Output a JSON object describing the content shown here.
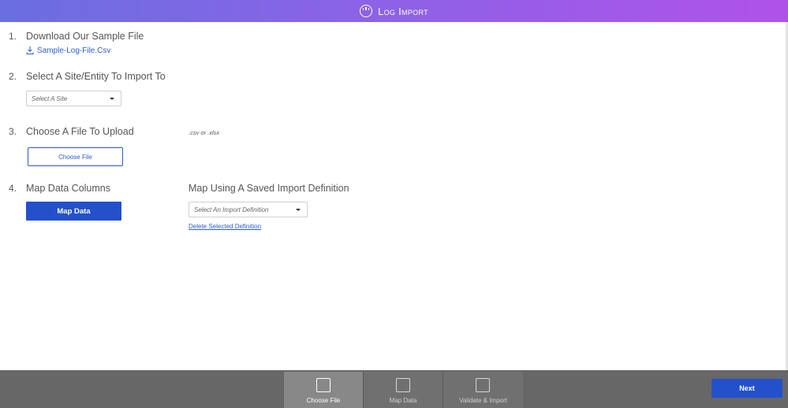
{
  "header": {
    "title": "Log Import",
    "logo_icon": "timer-logo-icon"
  },
  "steps": [
    {
      "number": "1.",
      "title": "Download Our Sample File"
    },
    {
      "number": "2.",
      "title": "Select A Site/Entity To Import To"
    },
    {
      "number": "3.",
      "title": "Choose A File To Upload"
    },
    {
      "number": "4.",
      "title": "Map Data Columns"
    }
  ],
  "sample_file": {
    "link_text": "Sample-Log-File.Csv",
    "icon": "download-icon"
  },
  "site_select": {
    "placeholder": "Select A Site"
  },
  "upload": {
    "hint": ".csv or .xlsx",
    "choose_label": "Choose File"
  },
  "map": {
    "button_label": "Map Data",
    "saved_title": "Map Using A Saved Import Definition",
    "definition_placeholder": "Select An Import Definition",
    "delete_link": "Delete Selected Definition"
  },
  "footer": {
    "tabs": [
      {
        "label": "Choose File",
        "active": true
      },
      {
        "label": "Map Data",
        "active": false
      },
      {
        "label": "Validate & Import",
        "active": false
      }
    ],
    "next_label": "Next"
  },
  "colors": {
    "header_gradient_start": "#6a6ee0",
    "header_gradient_end": "#b052ea",
    "primary_button": "#2351cc",
    "link": "#2a5bd7",
    "footer_bg": "#676767"
  }
}
